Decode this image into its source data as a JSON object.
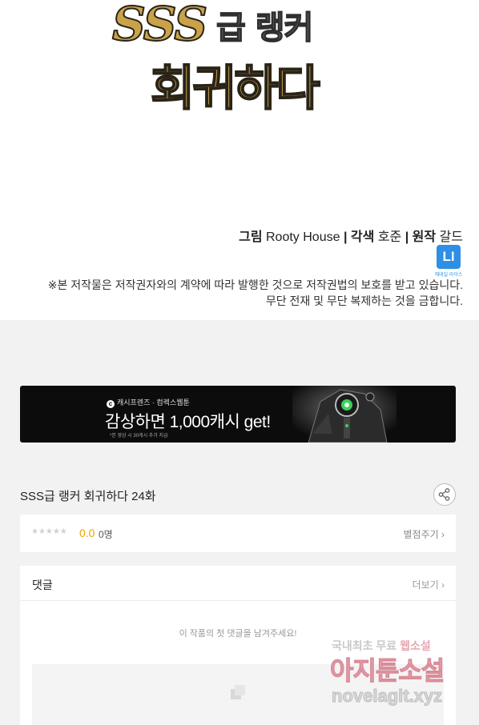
{
  "logo": {
    "line1_latin": "SSS",
    "line1_hangul": "급 랭커",
    "line2": "회귀하다"
  },
  "credits": {
    "art_label": "그림",
    "art_name": "Rooty House",
    "color_label": "각색",
    "color_name": "호준",
    "original_label": "원작",
    "original_name": "갈드",
    "separator": "|"
  },
  "li_badge": {
    "text": "LI",
    "caption": "해데일 라이스"
  },
  "notice": {
    "line1": "※본 저작물은 저작권자와의 계약에 따라 발행한 것으로 저작권법의 보호를 받고 있습니다.",
    "line2": "무단 전재 및 무단 복제하는 것을 금합니다."
  },
  "banner": {
    "brand_text": "캐시프렌즈 · 컴렉스웹툰",
    "headline": "감상하면 1,000캐시 get!",
    "fine_print": "*본 영상 시 30캐시 추가 지급"
  },
  "episode": {
    "title": "SSS급 랭커 회귀하다 24화"
  },
  "rating": {
    "stars": "★★★★★",
    "score": "0.0",
    "count": "0명",
    "rate_link": "별점주기 ›"
  },
  "comments": {
    "label": "댓글",
    "more_link": "더보기 ›",
    "empty_message": "이 작품의 첫 댓글을 남겨주세요!"
  },
  "watermark": {
    "line1_a": "국내최초 무료",
    "line1_b": "웹소설",
    "line2": "아지툰소설",
    "line3": "novelagit.xyz"
  },
  "colors": {
    "accent_score": "#f0a300",
    "li_badge": "#2d8fe5",
    "page_bg": "#f2f2f2"
  },
  "icons": {
    "share": "share-icon",
    "comment_image": "image-placeholder-icon",
    "banner_brand": "cashfriends-logo-icon"
  }
}
